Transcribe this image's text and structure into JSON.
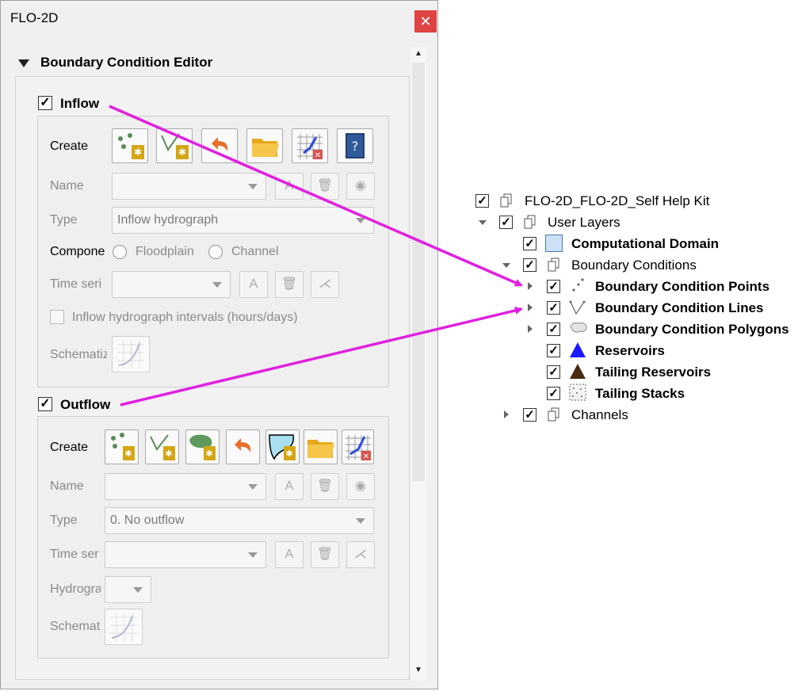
{
  "window": {
    "title": "FLO-2D",
    "close_glyph": "✕"
  },
  "editor": {
    "title": "Boundary Condition Editor"
  },
  "inflow": {
    "label": "Inflow",
    "checked": true,
    "create_label": "Create",
    "name_label": "Name",
    "type_label": "Type",
    "type_value": "Inflow hydrograph",
    "component_label": "Compone",
    "floodplain_label": "Floodplain",
    "channel_label": "Channel",
    "time_series_label": "Time seri",
    "intervals_label": "Inflow hydrograph intervals (hours/days)",
    "schematic_label": "Schematiz"
  },
  "outflow": {
    "label": "Outflow",
    "checked": true,
    "create_label": "Create",
    "name_label": "Name",
    "type_label": "Type",
    "type_value": "0. No outflow",
    "time_series_label": "Time ser",
    "hydrograph_label": "Hydrogra",
    "schematic_label": "Schemat"
  },
  "layers": {
    "root": "FLO-2D_FLO-2D_Self Help Kit",
    "user_layers": "User Layers",
    "computational_domain": "Computational Domain",
    "boundary_conditions": "Boundary Conditions",
    "bc_points": "Boundary Condition Points",
    "bc_lines": "Boundary Condition Lines",
    "bc_polygons": "Boundary Condition Polygons",
    "reservoirs": "Reservoirs",
    "tailing_reservoirs": "Tailing Reservoirs",
    "tailing_stacks": "Tailing Stacks",
    "channels": "Channels"
  },
  "colors": {
    "arrow": "#e020e0",
    "close": "#e04343",
    "reservoir": "#1a1aff",
    "tailing": "#4a2a14"
  }
}
